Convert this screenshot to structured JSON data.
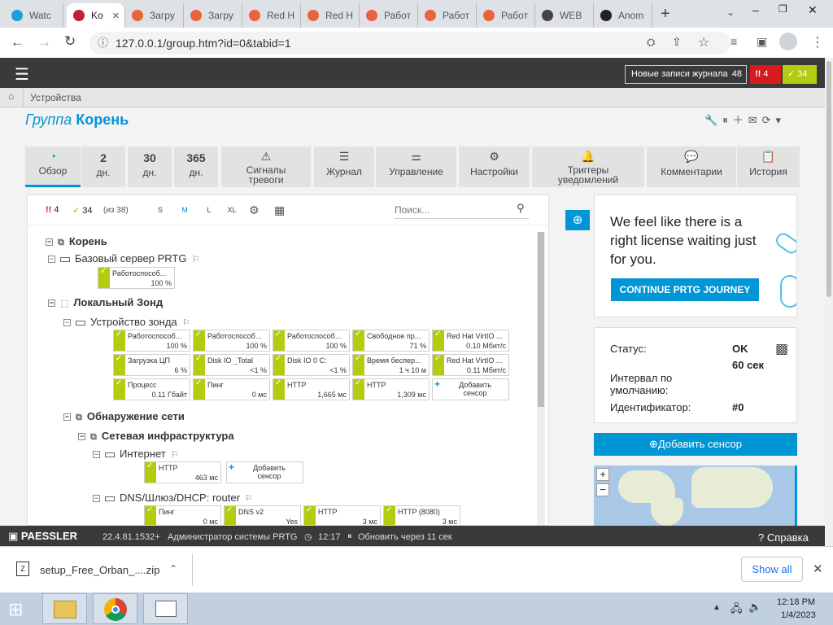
{
  "browser": {
    "tabs": [
      {
        "label": "Watc",
        "color": "#1aa2d6"
      },
      {
        "label": "Ko",
        "color": "#c41e3a"
      },
      {
        "label": "Загру",
        "color": "#e8643c"
      },
      {
        "label": "Загру",
        "color": "#e8643c"
      },
      {
        "label": "Red H",
        "color": "#e8643c"
      },
      {
        "label": "Red H",
        "color": "#e8643c"
      },
      {
        "label": "Работ",
        "color": "#e8643c"
      },
      {
        "label": "Работ",
        "color": "#e8643c"
      },
      {
        "label": "Работ",
        "color": "#e8643c"
      },
      {
        "label": "WEB",
        "color": "#444444"
      },
      {
        "label": "Anom",
        "color": "#222222"
      }
    ],
    "url": "127.0.0.1/group.htm?id=0&tabid=1"
  },
  "header": {
    "journal_label": "Новые записи журнала",
    "journal_count": "48",
    "alarm_count": "4",
    "ok_count": "34"
  },
  "breadcrumb": "Устройства",
  "title": {
    "prefix": "Группа",
    "name": "Корень"
  },
  "navtabs": [
    {
      "top": "",
      "label": "Обзор"
    },
    {
      "top": "2",
      "label": "дн."
    },
    {
      "top": "30",
      "label": "дн."
    },
    {
      "top": "365",
      "label": "дн."
    },
    {
      "top": "⚠",
      "label": "Сигналы тревоги"
    },
    {
      "top": "☰",
      "label": "Журнал"
    },
    {
      "top": "⚌",
      "label": "Управление"
    },
    {
      "top": "⚙",
      "label": "Настройки"
    },
    {
      "top": "🔔",
      "label": "Триггеры уведомлений"
    },
    {
      "top": "💬",
      "label": "Комментарии"
    },
    {
      "top": "📋",
      "label": "История"
    }
  ],
  "toolbar": {
    "alarm": "4",
    "ok": "34",
    "of": "(из 38)",
    "sizes": [
      "S",
      "M",
      "L",
      "XL"
    ],
    "search_placeholder": "Поиск..."
  },
  "tree": {
    "root": "Корень",
    "base_server": "Базовый сервер PRTG",
    "local_probe": "Локальный Зонд",
    "probe_device": "Устройство зонда",
    "net_discovery": "Обнаружение сети",
    "net_infra": "Сетевая инфраструктура",
    "internet": "Интернет",
    "dns": "DNS/Шлюз/DHCP: router",
    "base_sensor": {
      "name": "Работоспособ...",
      "value": "100 %"
    },
    "probe_sensors": [
      {
        "name": "Работоспособ...",
        "value": "100 %"
      },
      {
        "name": "Работоспособ...",
        "value": "100 %"
      },
      {
        "name": "Работоспособ...",
        "value": "100 %"
      },
      {
        "name": "Свободное пр...",
        "value": "71 %"
      },
      {
        "name": "Red Hat VirtIO ...",
        "value": "0.10 Мбит/с"
      },
      {
        "name": "Загрузка ЦП",
        "value": "6 %"
      },
      {
        "name": "Disk IO _Total",
        "value": "<1 %"
      },
      {
        "name": "Disk IO 0 C:",
        "value": "<1 %"
      },
      {
        "name": "Время беспер...",
        "value": "1 ч 10 м"
      },
      {
        "name": "Red Hat VirtIO ...",
        "value": "0.11 Мбит/с"
      },
      {
        "name": "Процесс",
        "value": "0.11 Гбайт"
      },
      {
        "name": "Пинг",
        "value": "0 мс"
      },
      {
        "name": "HTTP",
        "value": "1,665 мс"
      },
      {
        "name": "HTTP",
        "value": "1,309 мс"
      }
    ],
    "add_sensor": "Добавить сенсор",
    "internet_sensor": {
      "name": "HTTP",
      "value": "463 мс"
    },
    "dns_sensors": [
      {
        "name": "Пинг",
        "value": "0 мс"
      },
      {
        "name": "DNS v2",
        "value": "Yes"
      },
      {
        "name": "HTTP",
        "value": "3 мс"
      },
      {
        "name": "HTTP (8080)",
        "value": "3 мс"
      }
    ]
  },
  "promo": {
    "text": "We feel like there is a right license waiting just for you.",
    "button": "CONTINUE PRTG JOURNEY"
  },
  "status": {
    "status_label": "Статус:",
    "status_value": "OK",
    "interval_label": "Интервал по умолчанию:",
    "interval_value": "60 сек",
    "id_label": "Идентификатор:",
    "id_value": "#0"
  },
  "add_sensor_button": "Добавить сенсор",
  "footer": {
    "brand": "PAESSLER",
    "version": "22.4.81.1532+",
    "user": "Администратор системы PRTG",
    "time": "12:17",
    "refresh": "Обновить через 11 сек",
    "help": "Справка"
  },
  "download": {
    "file": "setup_Free_Orban_....zip",
    "show_all": "Show all"
  },
  "taskbar": {
    "time": "12:18 PM",
    "date": "1/4/2023"
  },
  "colors": {
    "accent": "#0096d6",
    "ok": "#b4cc0f",
    "alarm": "#d71920"
  }
}
